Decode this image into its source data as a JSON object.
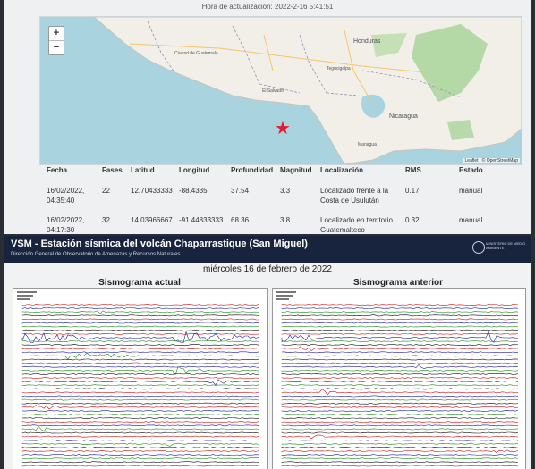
{
  "update": {
    "label": "Hora de actualización: 2022-2-16 5:41:51"
  },
  "map": {
    "zoom_in": "+",
    "zoom_out": "−",
    "attribution": "Leaflet | © OpenStreetMap",
    "labels": {
      "honduras": "Honduras",
      "nicaragua": "Nicaragua",
      "el_salvador": "El Salvador",
      "guatemala_city": "Ciudad de Guatemala",
      "tegucigalpa": "Tegucigalpa",
      "managua": "Managua"
    },
    "colors": {
      "water": "#a9d3df",
      "land": "#f2efe9",
      "forest": "#a9d39a",
      "star": "#e0202a"
    }
  },
  "table": {
    "headers": [
      "Fecha",
      "Fases",
      "Latitud",
      "Longitud",
      "Profundidad",
      "Magnitud",
      "Localización",
      "RMS",
      "Estado"
    ],
    "rows": [
      {
        "fecha": "16/02/2022, 04:35:40",
        "fases": "22",
        "latitud": "12.70433333",
        "longitud": "-88.4335",
        "profundidad": "37.54",
        "magnitud": "3.3",
        "localizacion": "Localizado frente a la Costa de Usulután",
        "rms": "0.17",
        "estado": "manual"
      },
      {
        "fecha": "16/02/2022, 04:17:30",
        "fases": "32",
        "latitud": "14.03966667",
        "longitud": "-91.44833333",
        "profundidad": "68.36",
        "magnitud": "3.8",
        "localizacion": "Localizado en territorio Guatemalteco",
        "rms": "0.32",
        "estado": "manual"
      }
    ]
  },
  "seismo": {
    "title": "VSM - Estación sísmica del volcán Chaparrastique (San Miguel)",
    "subtitle": "Dirección General de Observatorio de Amenazas y Recursos Naturales",
    "ministry": "MINISTERIO DE MEDIO AMBIENTE",
    "date": "miércoles 16 de febrero de 2022",
    "current": "Sismograma actual",
    "previous": "Sismograma anterior",
    "trace_colors": [
      "#cc1111",
      "#1a1aaa",
      "#1a8a1a",
      "#111111"
    ]
  }
}
